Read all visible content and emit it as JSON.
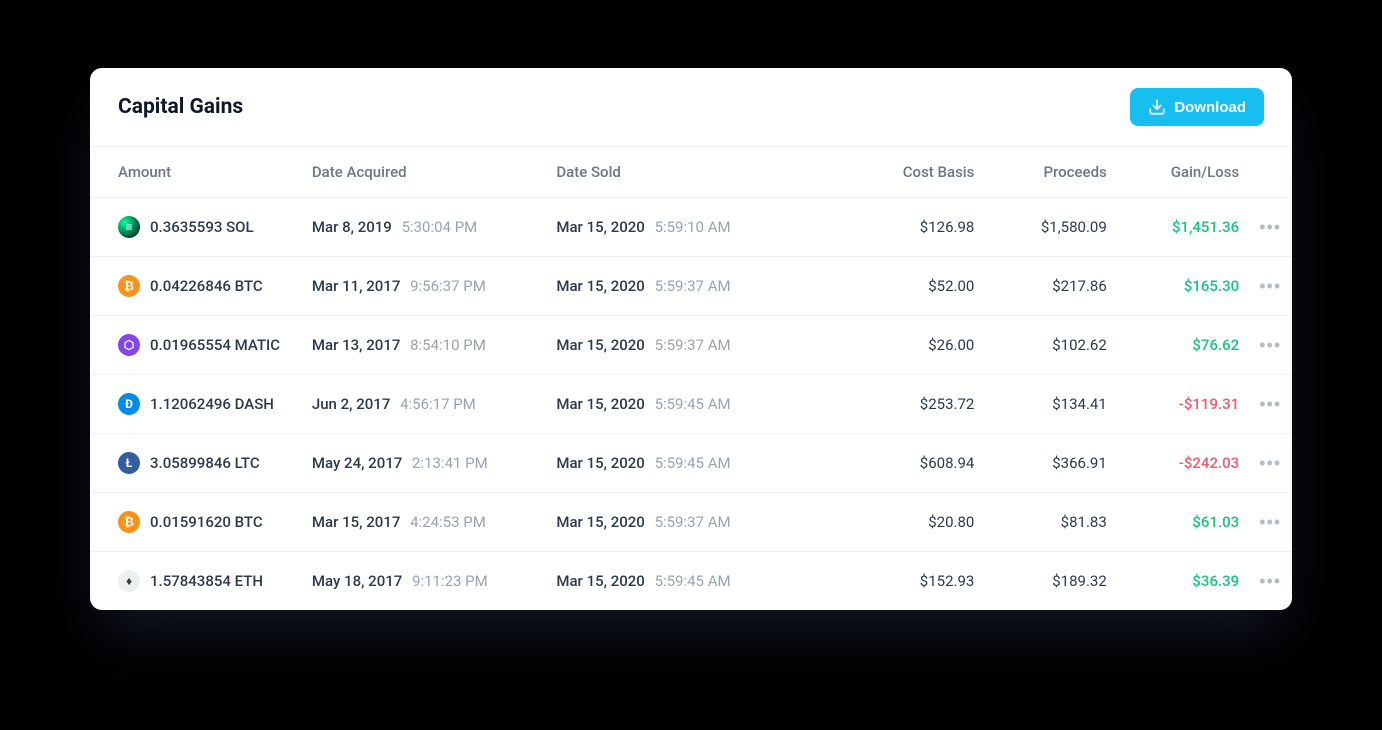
{
  "card": {
    "title": "Capital Gains",
    "download_label": "Download"
  },
  "columns": {
    "amount": "Amount",
    "date_acquired": "Date Acquired",
    "date_sold": "Date Sold",
    "cost_basis": "Cost Basis",
    "proceeds": "Proceeds",
    "gain_loss": "Gain/Loss"
  },
  "icon_palette": {
    "SOL": {
      "bg1": "#00FFA3",
      "bg2": "#000000",
      "fg": "#ffffff",
      "glyph": "≡"
    },
    "BTC": {
      "bg": "#f7931a",
      "fg": "#ffffff",
      "glyph": "₿"
    },
    "MATIC": {
      "bg": "#8247e5",
      "fg": "#ffffff",
      "glyph": "⬡"
    },
    "DASH": {
      "bg": "#008ce7",
      "fg": "#ffffff",
      "glyph": "Đ"
    },
    "LTC": {
      "bg": "#345d9d",
      "fg": "#ffffff",
      "glyph": "Ł"
    },
    "ETH": {
      "bg": "#ecf0f1",
      "fg": "#3c3c3d",
      "glyph": "♦"
    }
  },
  "rows": [
    {
      "coin": "SOL",
      "amount": "0.3635593 SOL",
      "acq_date": "Mar 8, 2019",
      "acq_time": "5:30:04 PM",
      "sold_date": "Mar 15, 2020",
      "sold_time": "5:59:10 AM",
      "cost_basis": "$126.98",
      "proceeds": "$1,580.09",
      "gain": "$1,451.36",
      "gain_sign": "pos"
    },
    {
      "coin": "BTC",
      "amount": "0.04226846 BTC",
      "acq_date": "Mar 11, 2017",
      "acq_time": "9:56:37 PM",
      "sold_date": "Mar 15, 2020",
      "sold_time": "5:59:37 AM",
      "cost_basis": "$52.00",
      "proceeds": "$217.86",
      "gain": "$165.30",
      "gain_sign": "pos"
    },
    {
      "coin": "MATIC",
      "amount": "0.01965554 MATIC",
      "acq_date": "Mar 13, 2017",
      "acq_time": "8:54:10 PM",
      "sold_date": "Mar 15, 2020",
      "sold_time": "5:59:37 AM",
      "cost_basis": "$26.00",
      "proceeds": "$102.62",
      "gain": "$76.62",
      "gain_sign": "pos"
    },
    {
      "coin": "DASH",
      "amount": "1.12062496 DASH",
      "acq_date": "Jun 2, 2017",
      "acq_time": "4:56:17 PM",
      "sold_date": "Mar 15, 2020",
      "sold_time": "5:59:45 AM",
      "cost_basis": "$253.72",
      "proceeds": "$134.41",
      "gain": "-$119.31",
      "gain_sign": "neg"
    },
    {
      "coin": "LTC",
      "amount": "3.05899846 LTC",
      "acq_date": "May 24, 2017",
      "acq_time": "2:13:41 PM",
      "sold_date": "Mar 15, 2020",
      "sold_time": "5:59:45 AM",
      "cost_basis": "$608.94",
      "proceeds": "$366.91",
      "gain": "-$242.03",
      "gain_sign": "neg"
    },
    {
      "coin": "BTC",
      "amount": "0.01591620 BTC",
      "acq_date": "Mar 15, 2017",
      "acq_time": "4:24:53 PM",
      "sold_date": "Mar 15, 2020",
      "sold_time": "5:59:37 AM",
      "cost_basis": "$20.80",
      "proceeds": "$81.83",
      "gain": "$61.03",
      "gain_sign": "pos"
    },
    {
      "coin": "ETH",
      "amount": "1.57843854 ETH",
      "acq_date": "May 18, 2017",
      "acq_time": "9:11:23 PM",
      "sold_date": "Mar 15, 2020",
      "sold_time": "5:59:45 AM",
      "cost_basis": "$152.93",
      "proceeds": "$189.32",
      "gain": "$36.39",
      "gain_sign": "pos"
    }
  ]
}
